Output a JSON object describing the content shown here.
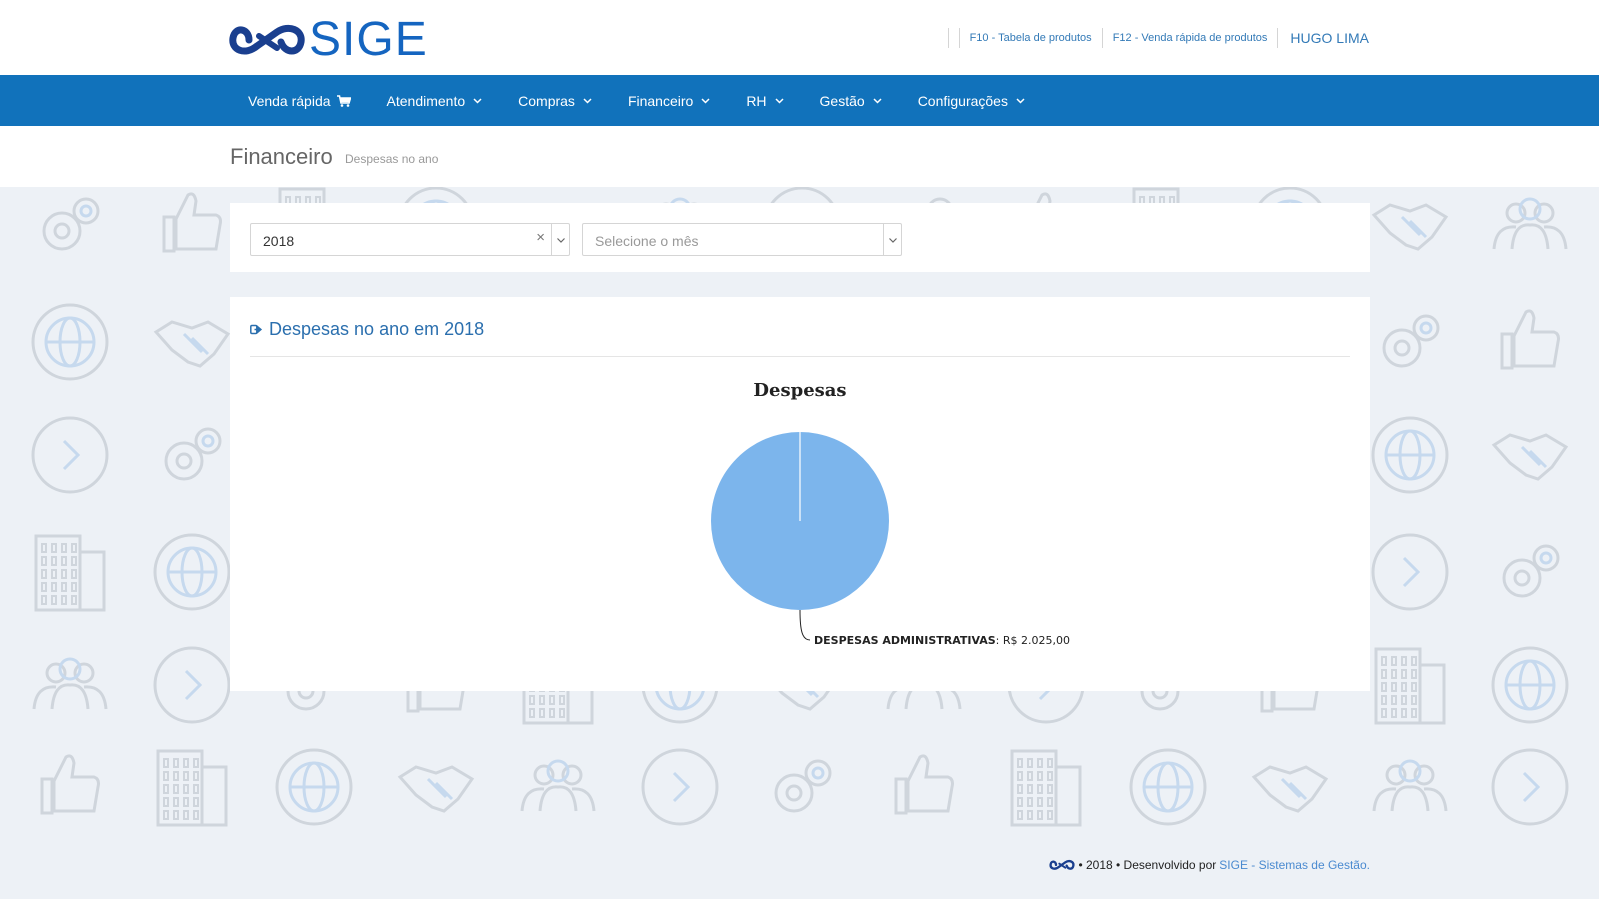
{
  "header": {
    "logo_text": "SIGE",
    "shortcut_products": "F10 - Tabela de produtos",
    "shortcut_quick_sale": "F12 - Venda rápida de produtos",
    "user_name": "HUGO LIMA"
  },
  "nav": {
    "items": [
      {
        "label": "Venda rápida",
        "icon": "cart-icon"
      },
      {
        "label": "Atendimento",
        "icon": "chevron-down-icon"
      },
      {
        "label": "Compras",
        "icon": "chevron-down-icon"
      },
      {
        "label": "Financeiro",
        "icon": "chevron-down-icon"
      },
      {
        "label": "RH",
        "icon": "chevron-down-icon"
      },
      {
        "label": "Gestão",
        "icon": "chevron-down-icon"
      },
      {
        "label": "Configurações",
        "icon": "chevron-down-icon"
      }
    ]
  },
  "page": {
    "title": "Financeiro",
    "subtitle": "Despesas no ano"
  },
  "filters": {
    "year_value": "2018",
    "month_placeholder": "Selecione o mês"
  },
  "panel": {
    "title": "Despesas no ano em 2018"
  },
  "chart_data": {
    "type": "pie",
    "title": "Despesas",
    "categories": [
      "DESPESAS ADMINISTRATIVAS"
    ],
    "values": [
      2025.0
    ],
    "value_labels": [
      "R$ 2.025,00"
    ],
    "colors": [
      "#7cb5ec"
    ]
  },
  "footer": {
    "text": "• 2018 • Desenvolvido por",
    "brand": "SIGE - Sistemas de Gestão."
  },
  "colors": {
    "nav_bg": "#1172bb",
    "brand_blue": "#1565c0",
    "link_blue": "#337ab7",
    "page_bg": "#edf1f6"
  }
}
